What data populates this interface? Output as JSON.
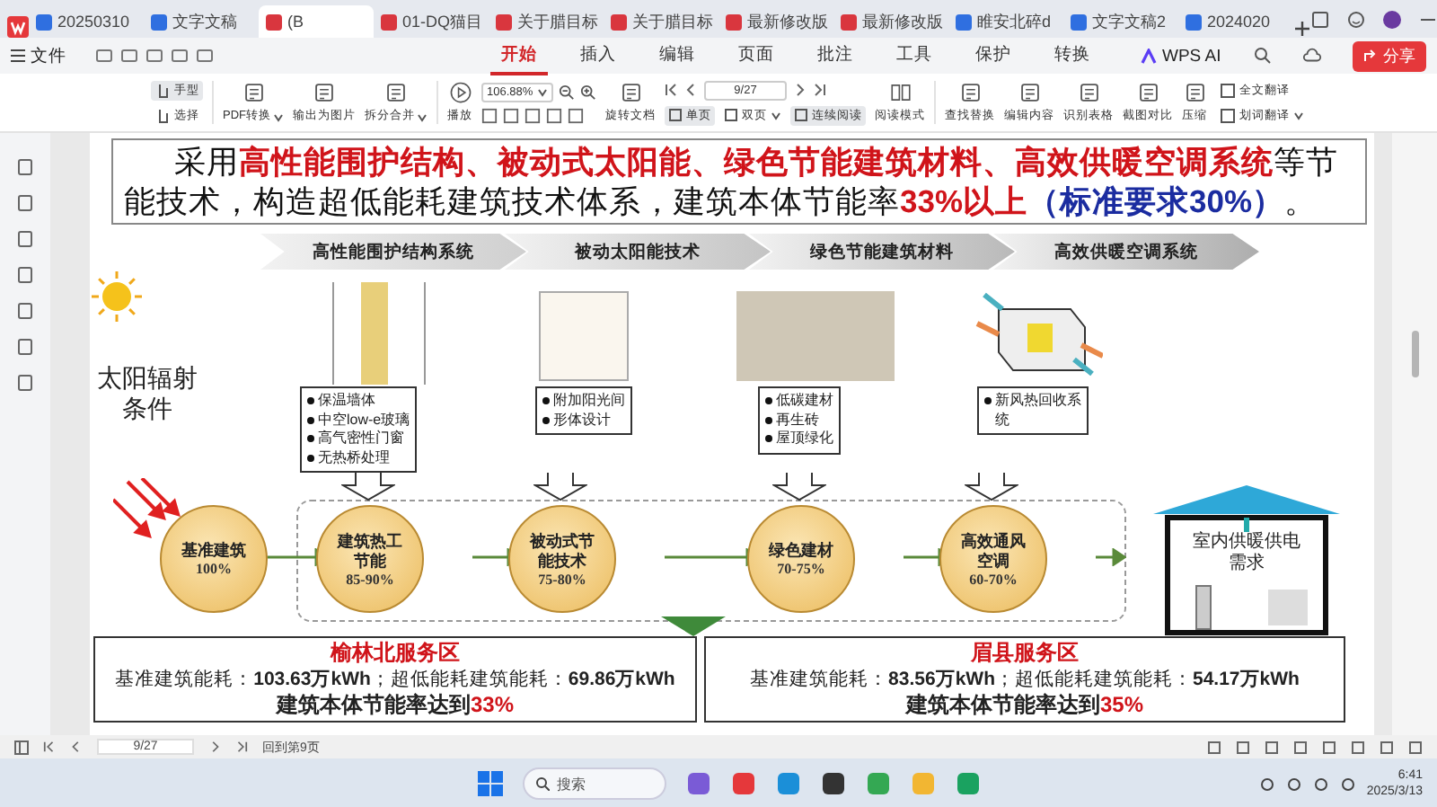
{
  "app_tabs": [
    {
      "label": "20250310",
      "kind": "doc",
      "selected": false
    },
    {
      "label": "文字文稿",
      "kind": "doc",
      "selected": false
    },
    {
      "label": "(B",
      "kind": "pdf",
      "selected": true
    },
    {
      "label": "01-DQ猫目",
      "kind": "pdf",
      "selected": false
    },
    {
      "label": "关于腊目标",
      "kind": "pdf",
      "selected": false
    },
    {
      "label": "关于腊目标",
      "kind": "pdf",
      "selected": false
    },
    {
      "label": "最新修改版",
      "kind": "pdf",
      "selected": false
    },
    {
      "label": "最新修改版",
      "kind": "pdf",
      "selected": false
    },
    {
      "label": "睢安北碎d",
      "kind": "doc",
      "selected": false
    },
    {
      "label": "文字文稿2",
      "kind": "doc",
      "selected": false
    },
    {
      "label": "2024020",
      "kind": "doc",
      "selected": false
    }
  ],
  "file_menu": "文件",
  "menu": [
    {
      "label": "开始",
      "selected": true
    },
    {
      "label": "插入",
      "selected": false
    },
    {
      "label": "编辑",
      "selected": false
    },
    {
      "label": "页面",
      "selected": false
    },
    {
      "label": "批注",
      "selected": false
    },
    {
      "label": "工具",
      "selected": false
    },
    {
      "label": "保护",
      "selected": false
    },
    {
      "label": "转换",
      "selected": false
    }
  ],
  "ai_menu": "WPS AI",
  "share_button": "分享",
  "toolbar": {
    "modes": [
      {
        "label": "手型",
        "selected": true
      },
      {
        "label": "选择",
        "selected": false
      }
    ],
    "actions": [
      {
        "label": "PDF转换",
        "dropdown": true
      },
      {
        "label": "输出为图片",
        "dropdown": false
      },
      {
        "label": "拆分合并",
        "dropdown": true
      }
    ],
    "play": "播放",
    "zoom": "106.88%",
    "page": "9/27",
    "rotate": "旋转文档",
    "layouts": [
      {
        "label": "单页",
        "selected": true,
        "dropdown": false
      },
      {
        "label": "双页",
        "selected": false,
        "dropdown": true
      },
      {
        "label": "连续阅读",
        "selected": true,
        "dropdown": false
      }
    ],
    "reading_mode": "阅读模式",
    "tools": [
      {
        "label": "查找替换"
      },
      {
        "label": "编辑内容"
      },
      {
        "label": "识别表格"
      },
      {
        "label": "截图对比"
      },
      {
        "label": "压缩"
      }
    ],
    "translate": [
      {
        "label": "全文翻译",
        "dropdown": false
      },
      {
        "label": "划词翻译",
        "dropdown": true
      }
    ]
  },
  "slide": {
    "intro": [
      {
        "text": "采用",
        "kind": "plain"
      },
      {
        "text": "高性能围护结构、被动式太阳能、绿色节能建筑材料、高效供暖空调系统",
        "kind": "emphasis"
      },
      {
        "text": "等节能技术，构造超低能耗建筑技术体系，建筑本体节能率",
        "kind": "plain"
      },
      {
        "text": "33%以上",
        "kind": "emphasis"
      },
      {
        "text": "（标准要求30%）",
        "kind": "note"
      },
      {
        "text": "。",
        "kind": "plain"
      }
    ],
    "steps": [
      "高性能围护结构系统",
      "被动太阳能技术",
      "绿色节能建筑材料",
      "高效供暖空调系统"
    ],
    "sun_label": "太阳辐射条件",
    "measures": [
      {
        "bullets": [
          "保温墙体",
          "中空low-e玻璃",
          "高气密性门窗",
          "无热桥处理"
        ]
      },
      {
        "bullets": [
          "附加阳光间",
          "形体设计"
        ]
      },
      {
        "bullets": [
          "低碳建材",
          "再生砖",
          "屋顶绿化"
        ]
      },
      {
        "bullets": [
          "新风热回收系统"
        ]
      }
    ],
    "stages": [
      {
        "title": "基准建筑",
        "percent": "100%"
      },
      {
        "title": "建筑热工节能",
        "percent": "85-90%"
      },
      {
        "title": "被动式节能技术",
        "percent": "75-80%"
      },
      {
        "title": "绿色建材",
        "percent": "70-75%"
      },
      {
        "title": "高效通风空调",
        "percent": "60-70%"
      }
    ],
    "demand": "室内供暖供电需求",
    "sites": [
      {
        "name": "榆林北服务区",
        "consumption": "基准建筑能耗：**103.63万kWh**；超低能耗建筑能耗：**69.86万kWh**",
        "rate_label": "建筑本体节能率达到",
        "rate": "33%"
      },
      {
        "name": "眉县服务区",
        "consumption": "基准建筑能耗：**83.56万kWh**；超低能耗建筑能耗：**54.17万kWh**",
        "rate_label": "建筑本体节能率达到",
        "rate": "35%"
      }
    ]
  },
  "status_bar": {
    "page": "9/27",
    "back_link": "回到第9页"
  },
  "taskbar": {
    "search": "搜索",
    "time": "6:41",
    "date": "2025/3/13"
  }
}
